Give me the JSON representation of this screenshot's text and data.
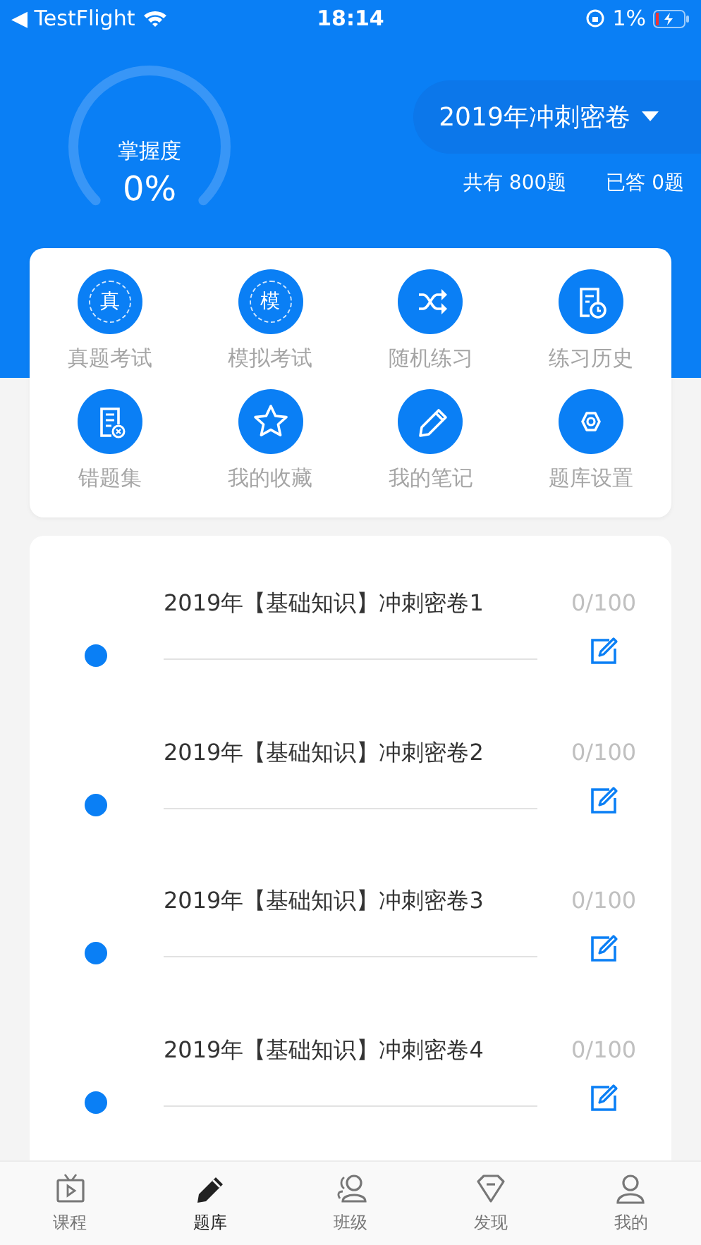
{
  "status_bar": {
    "back": "◀ TestFlight",
    "time": "18:14",
    "battery": "1%"
  },
  "mastery": {
    "label": "掌握度",
    "value": "0%"
  },
  "bank": {
    "title": "2019年冲刺密卷",
    "total": "共有 800题",
    "answered": "已答 0题"
  },
  "features": [
    {
      "label": "真题考试",
      "kind": "glyph",
      "glyph": "真"
    },
    {
      "label": "模拟考试",
      "kind": "glyph",
      "glyph": "模"
    },
    {
      "label": "随机练习",
      "kind": "shuffle"
    },
    {
      "label": "练习历史",
      "kind": "history"
    },
    {
      "label": "错题集",
      "kind": "wrong"
    },
    {
      "label": "我的收藏",
      "kind": "star"
    },
    {
      "label": "我的笔记",
      "kind": "pencil"
    },
    {
      "label": "题库设置",
      "kind": "settings"
    }
  ],
  "papers": [
    {
      "title": "2019年【基础知识】冲刺密卷1",
      "score": "0/100"
    },
    {
      "title": "2019年【基础知识】冲刺密卷2",
      "score": "0/100"
    },
    {
      "title": "2019年【基础知识】冲刺密卷3",
      "score": "0/100"
    },
    {
      "title": "2019年【基础知识】冲刺密卷4",
      "score": "0/100"
    }
  ],
  "tabs": [
    {
      "label": "课程",
      "kind": "tv",
      "selected": false
    },
    {
      "label": "题库",
      "kind": "pencil",
      "selected": true
    },
    {
      "label": "班级",
      "kind": "group",
      "selected": false
    },
    {
      "label": "发现",
      "kind": "gem",
      "selected": false
    },
    {
      "label": "我的",
      "kind": "person",
      "selected": false
    }
  ]
}
